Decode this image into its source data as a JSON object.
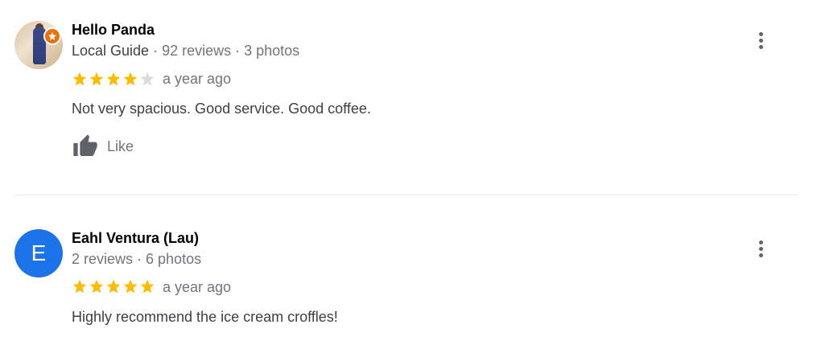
{
  "reviews": [
    {
      "name": "Hello Panda",
      "guide_label": "Local Guide",
      "meta": " · 92 reviews · 3 photos",
      "rating": 4,
      "when": "a year ago",
      "text": "Not very spacious. Good service. Good coffee.",
      "like_label": "Like",
      "avatar_icon": "user-photo-avatar"
    },
    {
      "name": "Eahl Ventura (Lau)",
      "meta": "2 reviews · 6 photos",
      "rating": 5,
      "when": "a year ago",
      "text": "Highly recommend the ice cream croffles!",
      "avatar_letter": "E",
      "avatar_color": "#1a73e8"
    }
  ],
  "colors": {
    "star_filled": "#fbbc04",
    "star_empty": "#dadce0",
    "badge": "#e8710a"
  }
}
